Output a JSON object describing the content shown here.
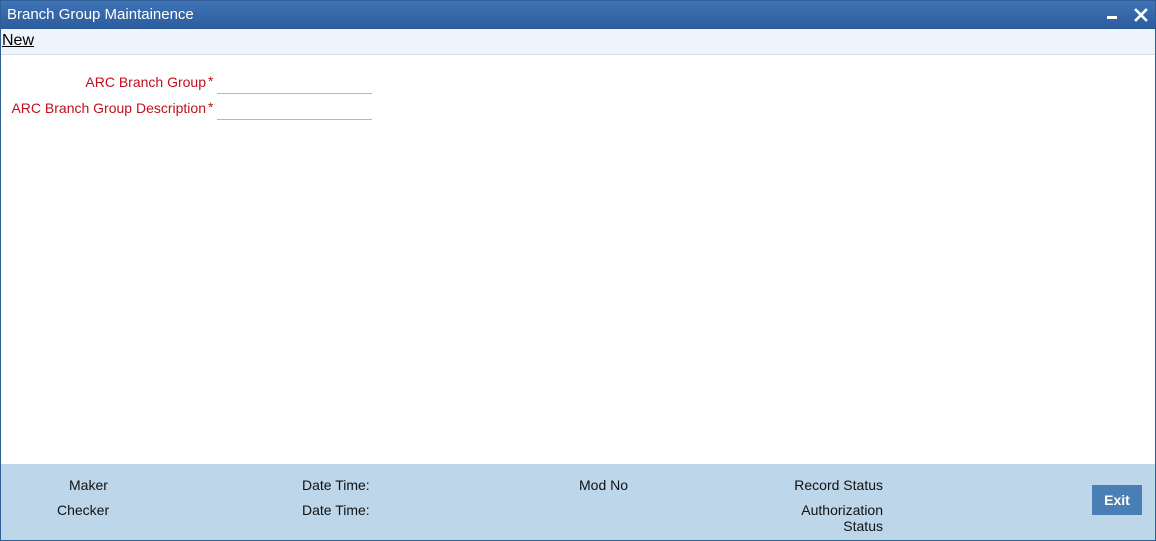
{
  "window": {
    "title": "Branch Group Maintainence"
  },
  "toolbar": {
    "new_label": "New"
  },
  "form": {
    "branch_group": {
      "label": "ARC Branch Group",
      "required_mark": "*",
      "value": ""
    },
    "branch_group_desc": {
      "label": "ARC Branch Group Description",
      "required_mark": "*",
      "value": ""
    }
  },
  "footer": {
    "maker": "Maker",
    "checker": "Checker",
    "date_time_1": "Date Time:",
    "date_time_2": "Date Time:",
    "mod_no": "Mod No",
    "record_status": "Record Status",
    "authorization_status_line1": "Authorization",
    "authorization_status_line2": "Status",
    "exit_label": "Exit"
  },
  "colors": {
    "titlebar": "#2c5c9c",
    "required": "#c0101e",
    "footer": "#bdd6ea",
    "exit_button": "#4a7fb5"
  }
}
